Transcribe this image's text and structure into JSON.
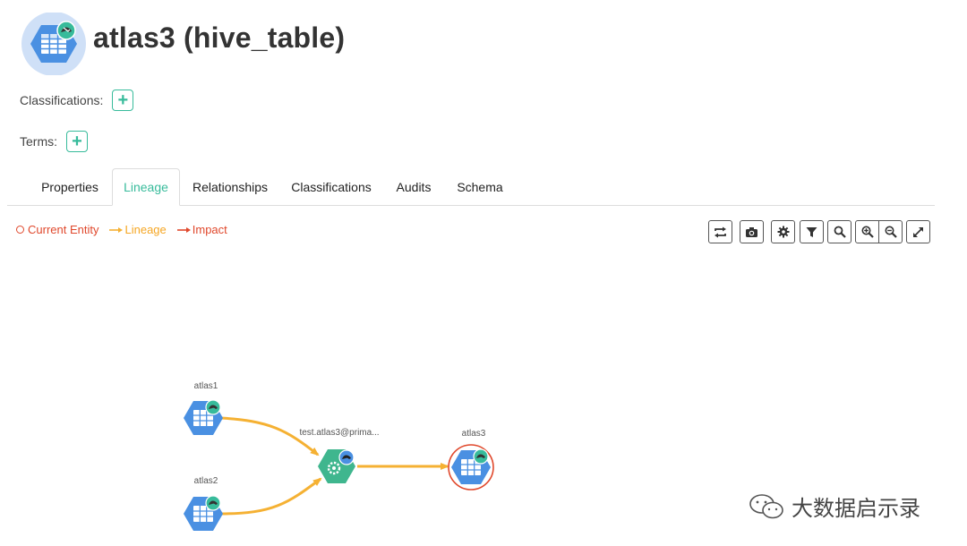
{
  "entity": {
    "title": "atlas3 (hive_table)",
    "icon": "hive-table-icon"
  },
  "classifications": {
    "label": "Classifications:",
    "add": "+"
  },
  "terms": {
    "label": "Terms:",
    "add": "+"
  },
  "tabs": [
    {
      "label": "Properties"
    },
    {
      "label": "Lineage",
      "active": true
    },
    {
      "label": "Relationships"
    },
    {
      "label": "Classifications"
    },
    {
      "label": "Audits"
    },
    {
      "label": "Schema"
    }
  ],
  "legend": {
    "current": "Current Entity",
    "lineage": "Lineage",
    "impact": "Impact"
  },
  "toolbar": [
    "refresh-icon",
    "camera-icon",
    "gear-icon",
    "filter-icon",
    "search-icon",
    "zoom-in-icon",
    "zoom-out-icon",
    "fullscreen-icon"
  ],
  "graph": {
    "nodes": {
      "atlas1": "atlas1",
      "atlas2": "atlas2",
      "process": "test.atlas3@prima...",
      "atlas3": "atlas3"
    }
  },
  "colors": {
    "accent": "#37bb9b",
    "table_node": "#4a90e2",
    "process_node": "#3fb68e",
    "lineage_edge": "#f5b133",
    "impact": "#e0482c"
  },
  "watermark": {
    "text": "大数据启示录"
  }
}
